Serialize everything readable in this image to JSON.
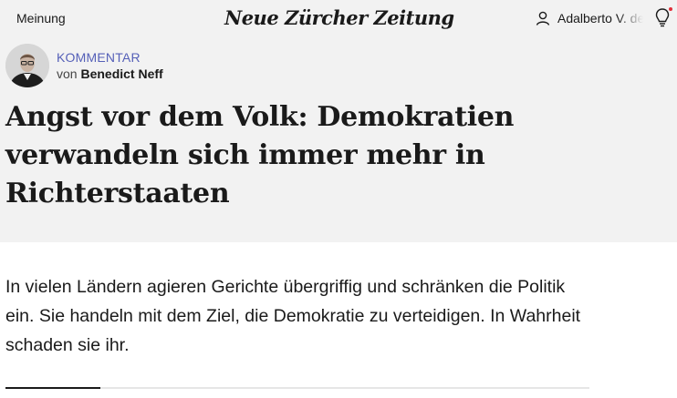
{
  "header": {
    "section": "Meinung",
    "logo": "Neue Zürcher Zeitung",
    "user_name": "Adalberto V. de",
    "accent_color": "#e0303a"
  },
  "article": {
    "kicker": "KOMMENTAR",
    "byline_prefix": "von",
    "author": "Benedict Neff",
    "title": "Angst vor dem Volk: Demokratien verwandeln sich immer mehr in Richterstaaten",
    "lead": "In vielen Ländern agieren Gerichte übergriffig und schränken die Politik ein. Sie handeln mit dem Ziel, die Demokratie zu verteidigen. In Wahrheit schaden sie ihr."
  }
}
